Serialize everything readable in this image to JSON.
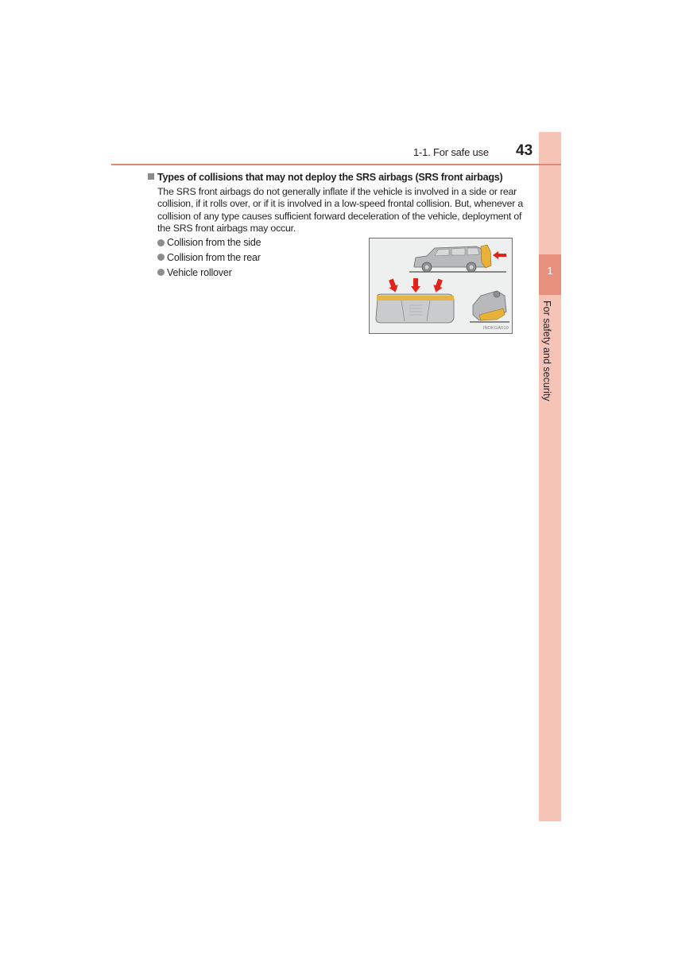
{
  "header": {
    "section_title": "1-1. For safe use",
    "page_number": "43"
  },
  "side_tab": {
    "chapter_number": "1",
    "chapter_title": "For safety and security",
    "color": "#f6c4b6",
    "highlight_color": "#e7907d"
  },
  "content": {
    "subheading": "Types of collisions that may not deploy the SRS airbags (SRS front airbags)",
    "paragraph": "The SRS front airbags do not generally inflate if the vehicle is involved in a side or rear collision, if it rolls over, or if it is involved in a low-speed frontal collision. But, whenever a collision of any type causes sufficient forward deceleration of the vehicle, deployment of the SRS front airbags may occur.",
    "bullets": [
      "Collision from the side",
      "Collision from the rear",
      "Vehicle rollover"
    ]
  },
  "figure": {
    "description": "Illustrations of rear collision, side collision (top view) and rollover",
    "code": "INDKGA010",
    "arrow_color": "#e2231a",
    "impact_color": "#e8b23a"
  }
}
